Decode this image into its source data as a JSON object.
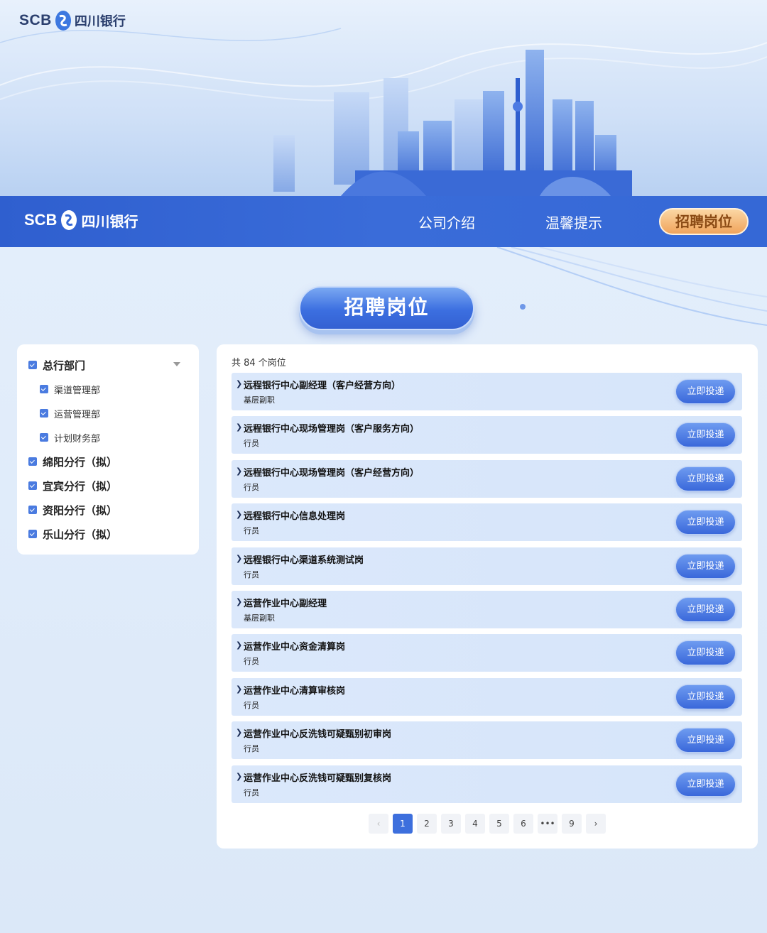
{
  "header": {
    "logo_latin": "SCB",
    "logo_cn": "四川银行"
  },
  "nav": {
    "logo_latin": "SCB",
    "logo_cn": "四川银行",
    "items": [
      {
        "label": "公司介绍"
      },
      {
        "label": "温馨提示"
      },
      {
        "label": "招聘岗位"
      }
    ]
  },
  "section_title": "招聘岗位",
  "sidebar": {
    "groups": [
      {
        "label": "总行部门",
        "checked": true,
        "expanded": true,
        "children": [
          {
            "label": "渠道管理部",
            "checked": true
          },
          {
            "label": "运营管理部",
            "checked": true
          },
          {
            "label": "计划财务部",
            "checked": true
          }
        ]
      },
      {
        "label": "绵阳分行（拟）",
        "checked": true
      },
      {
        "label": "宜宾分行（拟）",
        "checked": true
      },
      {
        "label": "资阳分行（拟）",
        "checked": true
      },
      {
        "label": "乐山分行（拟）",
        "checked": true
      }
    ]
  },
  "jobs": {
    "count_label": "共 84 个岗位",
    "apply_label": "立即投递",
    "items": [
      {
        "title": "远程银行中心副经理（客户经营方向）",
        "level": "基层副职"
      },
      {
        "title": "远程银行中心现场管理岗（客户服务方向）",
        "level": "行员"
      },
      {
        "title": "远程银行中心现场管理岗（客户经营方向）",
        "level": "行员"
      },
      {
        "title": "远程银行中心信息处理岗",
        "level": "行员"
      },
      {
        "title": "远程银行中心渠道系统测试岗",
        "level": "行员"
      },
      {
        "title": "运营作业中心副经理",
        "level": "基层副职"
      },
      {
        "title": "运营作业中心资金清算岗",
        "level": "行员"
      },
      {
        "title": "运营作业中心清算审核岗",
        "level": "行员"
      },
      {
        "title": "运营作业中心反洗钱可疑甄别初审岗",
        "level": "行员"
      },
      {
        "title": "运营作业中心反洗钱可疑甄别复核岗",
        "level": "行员"
      }
    ]
  },
  "pagination": {
    "prev": "‹",
    "pages": [
      "1",
      "2",
      "3",
      "4",
      "5",
      "6",
      "•••",
      "9"
    ],
    "current": "1",
    "next": "›"
  },
  "colors": {
    "nav_blue": "#3568d6",
    "accent_orange": "#f0a45c",
    "row_bg": "#d6e5fa",
    "button_blue": "#3a68da"
  }
}
